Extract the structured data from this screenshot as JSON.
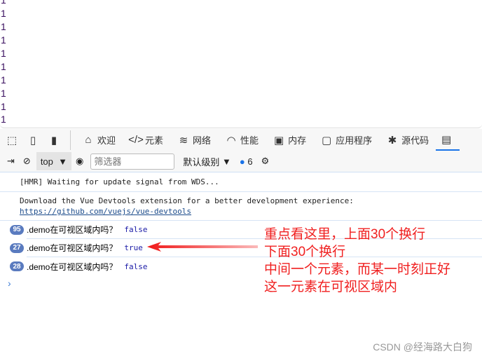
{
  "page": {
    "lines": [
      "1",
      "1",
      "1",
      "1",
      "1",
      "1",
      "1",
      "1",
      "1",
      "1"
    ]
  },
  "tabs": [
    {
      "icon": "home-icon",
      "label": "欢迎"
    },
    {
      "icon": "code-icon",
      "label": "元素"
    },
    {
      "icon": "wifi-icon",
      "label": "网络"
    },
    {
      "icon": "gauge-icon",
      "label": "性能"
    },
    {
      "icon": "chip-icon",
      "label": "内存"
    },
    {
      "icon": "window-icon",
      "label": "应用程序"
    },
    {
      "icon": "bug-icon",
      "label": "源代码"
    }
  ],
  "toolbar": {
    "context": "top",
    "filter_placeholder": "筛选器",
    "level": "默认级别",
    "message_count": "6"
  },
  "console": {
    "hmr": "[HMR] Waiting for update signal from WDS...",
    "vue": "Download the Vue Devtools extension for a better development experience:",
    "vue_link": "https://github.com/vuejs/vue-devtools",
    "rows": [
      {
        "count": "95",
        "text": ".demo在可视区域内吗？",
        "value": "false"
      },
      {
        "count": "27",
        "text": ".demo在可视区域内吗？",
        "value": "true"
      },
      {
        "count": "28",
        "text": ".demo在可视区域内吗？",
        "value": "false"
      }
    ]
  },
  "annotation": [
    "重点看这里，上面30个换行",
    "下面30个换行",
    "中间一个元素，而某一时刻正好",
    "这一元素在可视区域内"
  ],
  "watermark": "CSDN @经海路大白狗",
  "colors": {
    "annotation": "#f02020",
    "badge": "#5a7bbf",
    "value": "#1a1aa6"
  }
}
